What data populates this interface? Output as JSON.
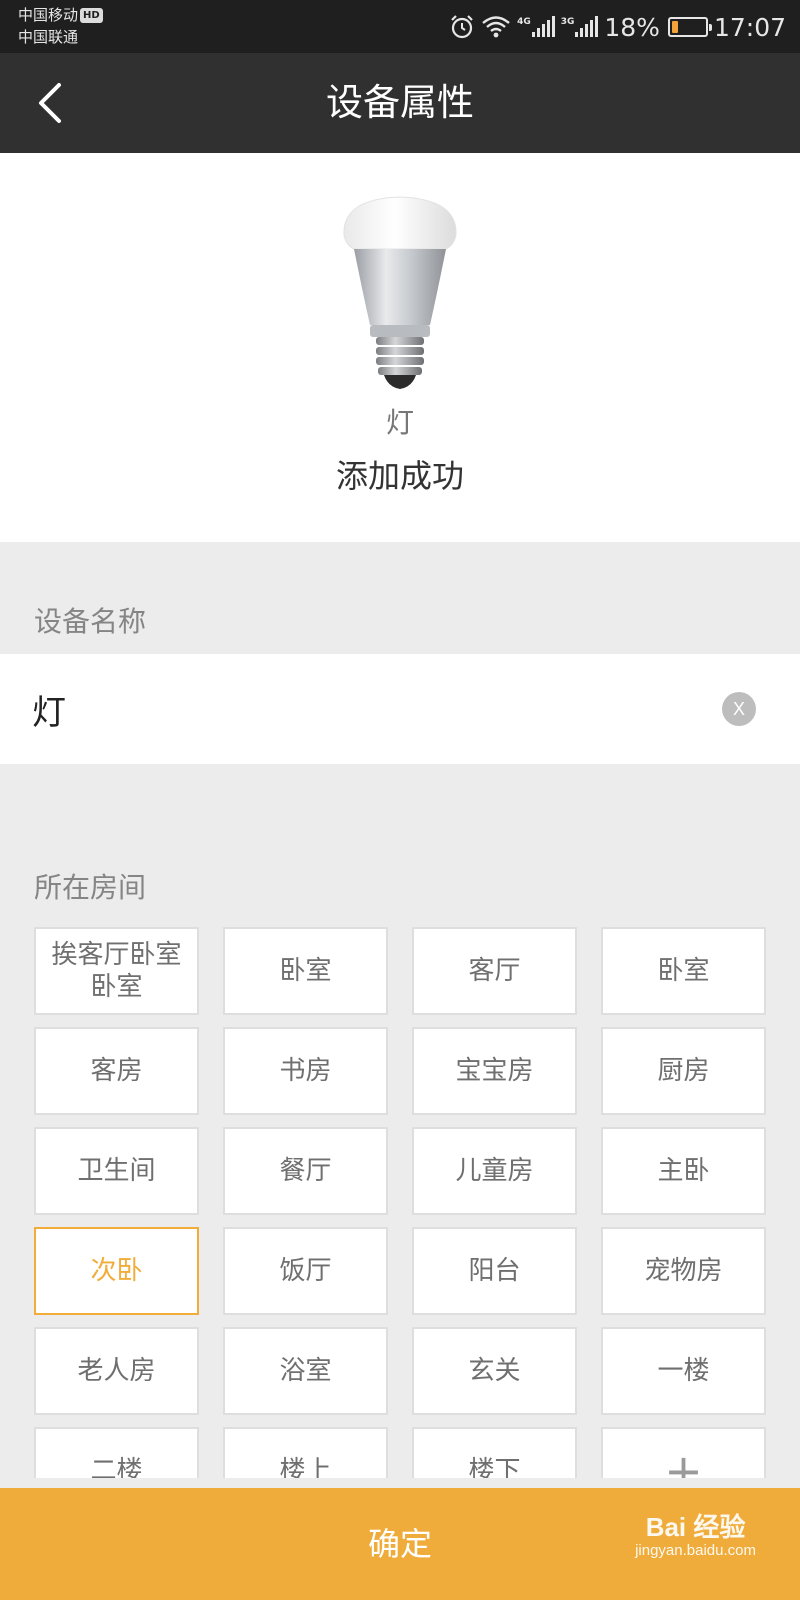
{
  "status_bar": {
    "carrier_1": "中国移动",
    "hd_badge": "HD",
    "carrier_2": "中国联通",
    "net_1": "4G",
    "net_2": "3G",
    "battery_percent": "18%",
    "battery_level": 0.18,
    "time": "17:07",
    "icons": [
      "alarm-icon",
      "wifi-icon",
      "signal-icon",
      "battery-icon"
    ]
  },
  "header": {
    "title": "设备属性",
    "back_icon": "chevron-left-icon"
  },
  "device": {
    "type": "灯",
    "status": "添加成功",
    "image": "light-bulb"
  },
  "name_section": {
    "label": "设备名称",
    "value": "灯",
    "clear_label": "X"
  },
  "room_section": {
    "label": "所在房间",
    "rooms": [
      "挨客厅卧室卧室",
      "卧室",
      "客厅",
      "卧室",
      "客房",
      "书房",
      "宝宝房",
      "厨房",
      "卫生间",
      "餐厅",
      "儿童房",
      "主卧",
      "次卧",
      "饭厅",
      "阳台",
      "宠物房",
      "老人房",
      "浴室",
      "玄关",
      "一楼",
      "二楼",
      "楼上",
      "楼下"
    ],
    "selected_index": 12,
    "add_label": "+"
  },
  "footer": {
    "confirm_label": "确定"
  },
  "watermark": {
    "brand": "Bai 经验",
    "url": "jingyan.baidu.com"
  },
  "colors": {
    "accent": "#f0ac3b",
    "header_bg": "#303030",
    "status_bg": "#1f1f1f",
    "page_bg": "#ececec"
  }
}
